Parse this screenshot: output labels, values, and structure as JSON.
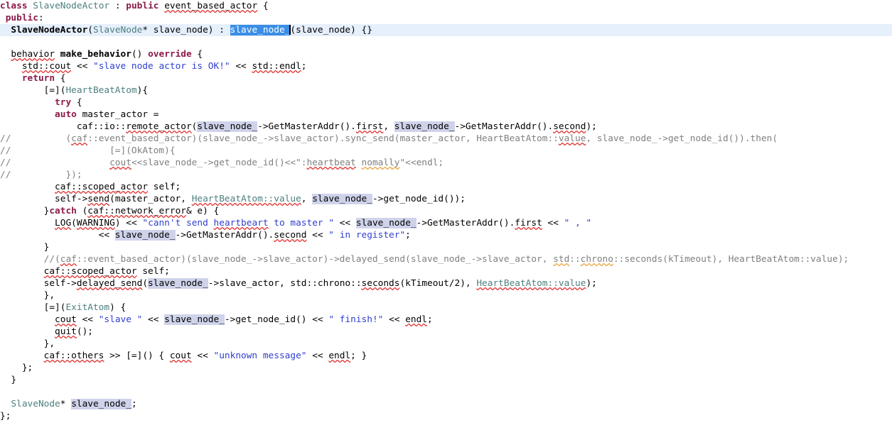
{
  "editor": {
    "language": "cpp",
    "colors": {
      "background": "#ffffff",
      "current_line": "#e6effc",
      "selection": "#3a8ee6",
      "selection_text": "#ffffff",
      "occurrence_highlight": "#cfd3ea",
      "keyword": "#8b1a4a",
      "type": "#4e7f7f",
      "string": "#2f3fd0",
      "comment": "#808080",
      "text": "#000000",
      "spellcheck_underline": "#e03030"
    },
    "cursor_line_index": 2,
    "selected_text": "slave_node_"
  },
  "code": {
    "lines": [
      "class SlaveNodeActor : public event_based_actor {",
      " public:",
      "  SlaveNodeActor(SlaveNode* slave_node) : slave_node_(slave_node) {}",
      "",
      "  behavior make_behavior() override {",
      "    std::cout << \"slave node actor is OK!\" << std::endl;",
      "    return {",
      "        [=](HeartBeatAtom){",
      "          try {",
      "          auto master_actor =",
      "              caf::io::remote_actor(slave_node_->GetMasterAddr().first, slave_node_->GetMasterAddr().second);",
      "//          (caf::event_based_actor)(slave_node_->slave_actor).sync_send(master_actor, HeartBeatAtom::value, slave_node_->get_node_id()).then(",
      "//                  [=](OkAtom){",
      "//                  cout<<slave_node_->get_node_id()<<\":heartbeat nomally\"<<endl;",
      "//          });",
      "          caf::scoped_actor self;",
      "          self->send(master_actor, HeartBeatAtom::value, slave_node_->get_node_id());",
      "        }catch (caf::network_error& e) {",
      "          LOG(WARNING) << \"cann't send heartbeart to master \" << slave_node_->GetMasterAddr().first << \" , \"",
      "                  << slave_node_->GetMasterAddr().second << \" in register\";",
      "        }",
      "        //(caf::event_based_actor)(slave_node_->slave_actor)->delayed_send(slave_node_->slave_actor, std::chrono::seconds(kTimeout), HeartBeatAtom::value);",
      "        caf::scoped_actor self;",
      "        self->delayed_send(slave_node_->slave_actor, std::chrono::seconds(kTimeout/2), HeartBeatAtom::value);",
      "        },",
      "        [=](ExitAtom) {",
      "          cout << \"slave \" << slave_node_->get_node_id() << \" finish!\" << endl;",
      "          quit();",
      "        },",
      "        caf::others >> [=]() { cout << \"unknown message\" << endl; }",
      "    };",
      "  }",
      "",
      "  SlaveNode* slave_node_;",
      "};"
    ]
  }
}
